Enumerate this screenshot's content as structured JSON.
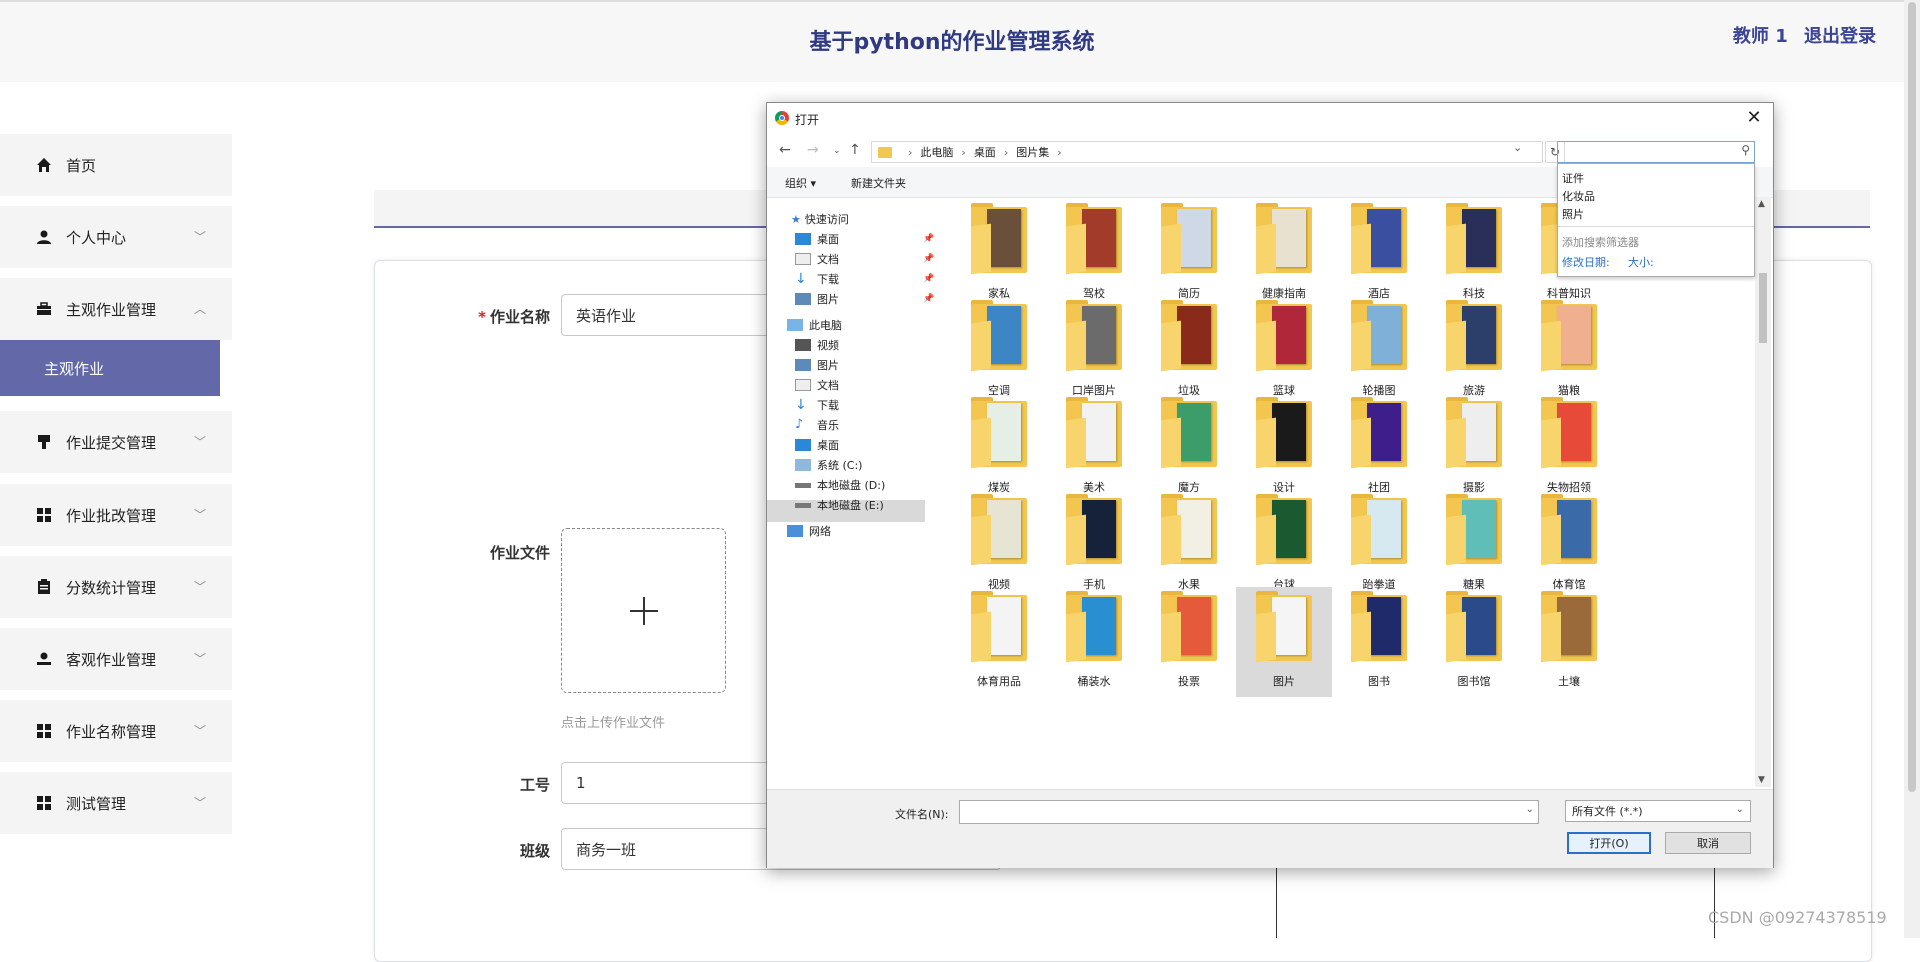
{
  "header": {
    "title": "基于python的作业管理系统",
    "user": "教师 1",
    "logout": "退出登录"
  },
  "sidebar": {
    "items": [
      {
        "label": "首页",
        "icon": "home-icon",
        "expandable": false
      },
      {
        "label": "个人中心",
        "icon": "user-icon",
        "expandable": true
      },
      {
        "label": "主观作业管理",
        "icon": "briefcase-icon",
        "expandable": true,
        "expanded": true
      },
      {
        "label": "作业提交管理",
        "icon": "stamp-icon",
        "expandable": true
      },
      {
        "label": "作业批改管理",
        "icon": "grid-icon",
        "expandable": true
      },
      {
        "label": "分数统计管理",
        "icon": "clipboard-icon",
        "expandable": true
      },
      {
        "label": "客观作业管理",
        "icon": "person-icon",
        "expandable": true
      },
      {
        "label": "作业名称管理",
        "icon": "grid-icon",
        "expandable": true
      },
      {
        "label": "测试管理",
        "icon": "grid-icon",
        "expandable": true
      }
    ],
    "active_subitem": "主观作业"
  },
  "form": {
    "homework_name_label": "作业名称",
    "homework_name_value": "英语作业",
    "homework_file_label": "作业文件",
    "upload_hint": "点击上传作业文件",
    "job_no_label": "工号",
    "job_no_value": "1",
    "class_label": "班级",
    "class_value": "商务一班"
  },
  "watermark": "CSDN @09274378519",
  "dialog": {
    "title": "打开",
    "breadcrumb": [
      "此电脑",
      "桌面",
      "图片集"
    ],
    "search_value": "",
    "search_suggestions": [
      "证件",
      "化妆品",
      "照片"
    ],
    "filter_header": "添加搜索筛选器",
    "filter_date": "修改日期:",
    "filter_size": "大小:",
    "toolbar": {
      "organize": "组织 ▾",
      "new_folder": "新建文件夹"
    },
    "nav": {
      "quick_access": "快速访问",
      "quick": [
        "桌面",
        "文档",
        "下载",
        "图片"
      ],
      "this_pc": "此电脑",
      "pc": [
        "视频",
        "图片",
        "文档",
        "下载",
        "音乐",
        "桌面",
        "系统 (C:)",
        "本地磁盘 (D:)",
        "本地磁盘 (E:)"
      ],
      "network": "网络"
    },
    "folders": [
      "家私",
      "驾校",
      "简历",
      "健康指南",
      "酒店",
      "科技",
      "科普知识",
      "空调",
      "口岸图片",
      "垃圾",
      "篮球",
      "轮播图",
      "旅游",
      "猫粮",
      "煤炭",
      "美术",
      "魔方",
      "设计",
      "社团",
      "摄影",
      "失物招领",
      "视频",
      "手机",
      "水果",
      "台球",
      "跆拳道",
      "糖果",
      "体育馆",
      "体育用品",
      "桶装水",
      "投票",
      "图片",
      "图书",
      "图书馆",
      "土壤"
    ],
    "selected_folder": "图片",
    "filename_label": "文件名(N):",
    "filename_value": "",
    "filetype": "所有文件 (*.*)",
    "open_button": "打开(O)",
    "cancel_button": "取消"
  }
}
